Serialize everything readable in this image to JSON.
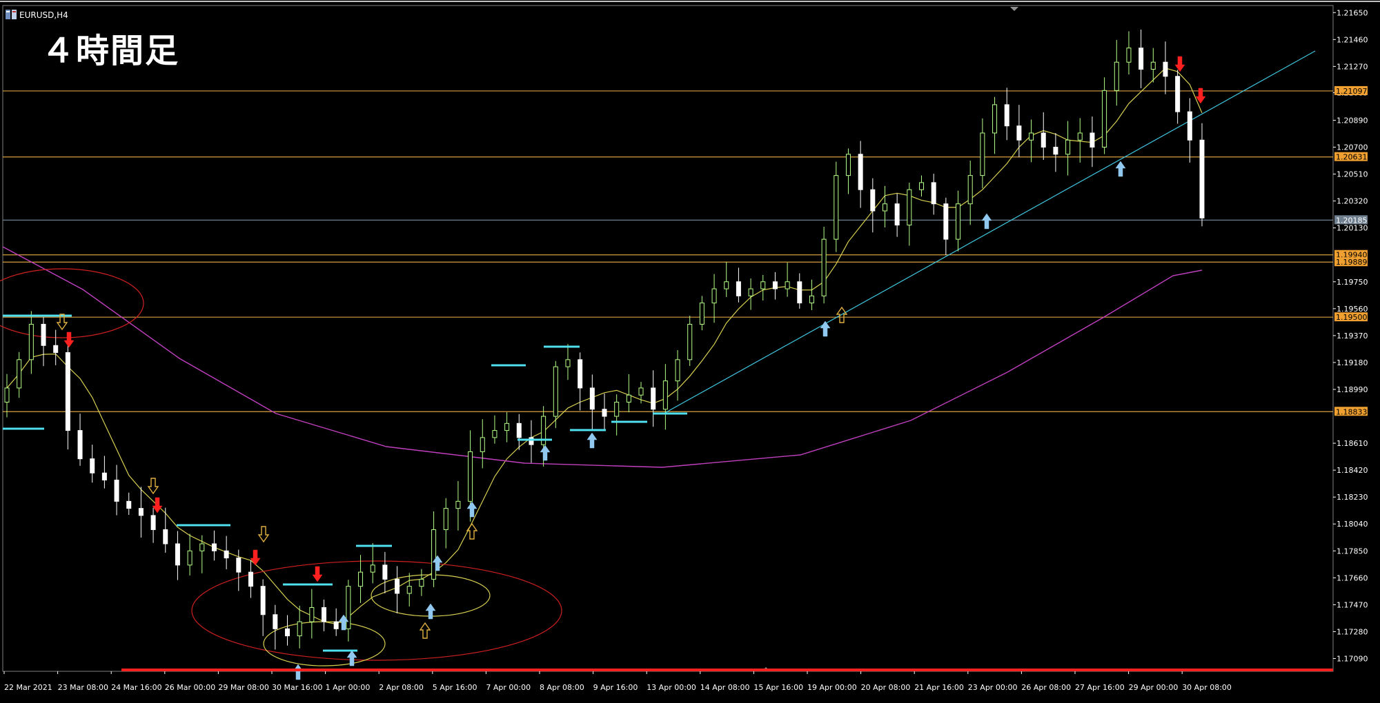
{
  "window": {
    "symbol": "EURUSD,H4",
    "title_overlay": "４時間足"
  },
  "colors": {
    "background": "#000000",
    "candle_up": "#b6ff87",
    "candle_down": "#ffffff",
    "level_line": "#d9a040",
    "tag_orange": "#f0a030",
    "tag_current": "#708090",
    "ma_fast": "#d8d050",
    "ma_slow": "#c040c0",
    "trendline": "#40c8e0",
    "support_line": "#ff2020",
    "ellipse_red": "#d02020",
    "ellipse_yellow": "#d8d050",
    "arrow_blue": "#90c8f0",
    "arrow_red": "#ff2020",
    "arrow_hollow": "#e0b040",
    "marker_cyan": "#50e0f0"
  },
  "price_axis": {
    "ticks": [
      "1.21650",
      "1.21460",
      "1.21270",
      "1.21085",
      "1.20890",
      "1.20700",
      "1.20510",
      "1.20320",
      "1.20130",
      "1.19750",
      "1.19560",
      "1.19370",
      "1.19180",
      "1.18990",
      "1.18610",
      "1.18420",
      "1.18230",
      "1.18040",
      "1.17850",
      "1.17660",
      "1.17470",
      "1.17280",
      "1.17090"
    ],
    "tagged_levels": [
      {
        "price": "1.21097",
        "style": "orange"
      },
      {
        "price": "1.20631",
        "style": "orange"
      },
      {
        "price": "1.20185",
        "style": "current"
      },
      {
        "price": "1.19940",
        "style": "orange"
      },
      {
        "price": "1.19889",
        "style": "orange"
      },
      {
        "price": "1.19500",
        "style": "orange"
      },
      {
        "price": "1.18833",
        "style": "orange"
      }
    ]
  },
  "time_axis": {
    "ticks": [
      "22 Mar 2021",
      "23 Mar 08:00",
      "24 Mar 16:00",
      "26 Mar 00:00",
      "29 Mar 08:00",
      "30 Mar 16:00",
      "1 Apr 00:00",
      "2 Apr 08:00",
      "5 Apr 16:00",
      "7 Apr 00:00",
      "8 Apr 08:00",
      "9 Apr 16:00",
      "13 Apr 00:00",
      "14 Apr 08:00",
      "15 Apr 16:00",
      "19 Apr 00:00",
      "20 Apr 08:00",
      "21 Apr 16:00",
      "23 Apr 00:00",
      "26 Apr 08:00",
      "27 Apr 16:00",
      "29 Apr 00:00",
      "30 Apr 08:00"
    ]
  },
  "chart_data": {
    "type": "candlestick",
    "symbol": "EURUSD",
    "timeframe": "H4",
    "ylim": [
      1.17,
      1.217
    ],
    "x_range": [
      "22 Mar 2021",
      "30 Apr 2021"
    ],
    "close_path": [
      1.19,
      1.192,
      1.1945,
      1.193,
      1.1925,
      1.187,
      1.185,
      1.184,
      1.1835,
      1.182,
      1.1815,
      1.181,
      1.18,
      1.179,
      1.1775,
      1.1785,
      1.179,
      1.1785,
      1.178,
      1.177,
      1.176,
      1.174,
      1.173,
      1.1725,
      1.1735,
      1.1745,
      1.1735,
      1.173,
      1.176,
      1.177,
      1.1775,
      1.1765,
      1.1755,
      1.176,
      1.1765,
      1.18,
      1.1815,
      1.182,
      1.1855,
      1.1865,
      1.187,
      1.1875,
      1.1865,
      1.186,
      1.188,
      1.1915,
      1.192,
      1.19,
      1.1885,
      1.188,
      1.189,
      1.1895,
      1.19,
      1.1885,
      1.1905,
      1.192,
      1.1945,
      1.196,
      1.197,
      1.1975,
      1.1965,
      1.197,
      1.1975,
      1.197,
      1.1975,
      1.196,
      1.1965,
      1.2005,
      1.205,
      1.2065,
      1.204,
      1.2025,
      1.203,
      1.2015,
      1.204,
      1.2045,
      1.203,
      1.2005,
      1.203,
      1.205,
      1.208,
      1.21,
      1.2085,
      1.2075,
      1.208,
      1.207,
      1.2065,
      1.2075,
      1.208,
      1.207,
      1.211,
      1.213,
      1.214,
      1.2125,
      1.213,
      1.212,
      1.2095,
      1.2075,
      1.202
    ],
    "last_price": "1.20185",
    "indicators": [
      "fast moving average (yellow)",
      "slow moving average (magenta)"
    ]
  }
}
